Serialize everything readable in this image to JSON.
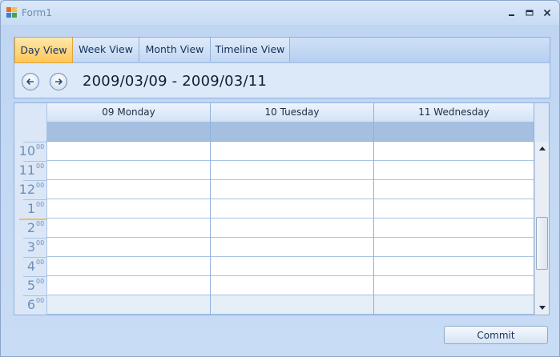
{
  "window": {
    "title": "Form1",
    "minimize_glyph": "‗",
    "maximize_glyph": "▬",
    "close_glyph": "✕"
  },
  "tabs": [
    {
      "label": "Day View",
      "active": true
    },
    {
      "label": "Week View",
      "active": false
    },
    {
      "label": "Month View",
      "active": false
    },
    {
      "label": "Timeline View",
      "active": false
    }
  ],
  "navigation": {
    "prev_icon": "arrow-left-icon",
    "next_icon": "arrow-right-icon",
    "date_range": "2009/03/09 - 2009/03/11"
  },
  "scheduler": {
    "days": [
      {
        "label": "09 Monday"
      },
      {
        "label": "10 Tuesday"
      },
      {
        "label": "11 Wednesday"
      }
    ],
    "hours": [
      {
        "hour": "10",
        "minutes": "00",
        "working": true
      },
      {
        "hour": "11",
        "minutes": "00",
        "working": true
      },
      {
        "hour": "12",
        "minutes": "00",
        "working": true
      },
      {
        "hour": "1",
        "minutes": "00",
        "working": true
      },
      {
        "hour": "2",
        "minutes": "00",
        "working": true
      },
      {
        "hour": "3",
        "minutes": "00",
        "working": true
      },
      {
        "hour": "4",
        "minutes": "00",
        "working": true
      },
      {
        "hour": "5",
        "minutes": "00",
        "working": true
      },
      {
        "hour": "6",
        "minutes": "00",
        "working": false
      }
    ]
  },
  "footer": {
    "commit_label": "Commit"
  },
  "colors": {
    "active_tab": "#ffc65a",
    "allday_row": "#a5bfe0",
    "grid_line": "#a9c3e6",
    "current_time": "#e5c365"
  }
}
